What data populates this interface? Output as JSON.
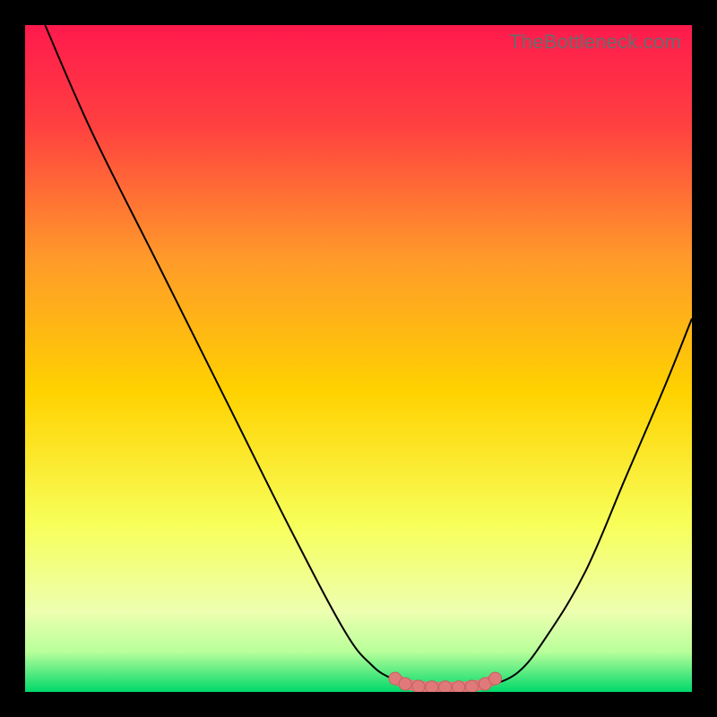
{
  "watermark": "TheBottleneck.com",
  "colors": {
    "black": "#000000",
    "curve": "#000000",
    "marker_fill": "#e07a7a",
    "marker_stroke": "#c95f5f",
    "grad_top": "#ff1a4d",
    "grad_mid_upper": "#ff7a3a",
    "grad_mid": "#ffd200",
    "grad_mid_lower": "#f7ff5a",
    "grad_pale": "#edffb0",
    "grad_green": "#00d86a"
  },
  "chart_data": {
    "type": "line",
    "title": "",
    "xlabel": "",
    "ylabel": "",
    "xlim": [
      0,
      100
    ],
    "ylim": [
      0,
      100
    ],
    "series": [
      {
        "name": "bottleneck-curve-left",
        "x": [
          3,
          10,
          20,
          30,
          40,
          48,
          52,
          55,
          58
        ],
        "y": [
          100,
          84,
          64,
          44,
          24,
          9,
          4,
          2,
          1
        ]
      },
      {
        "name": "bottleneck-curve-right",
        "x": [
          70,
          74,
          78,
          84,
          90,
          96,
          100
        ],
        "y": [
          1,
          3,
          8,
          18,
          32,
          46,
          56
        ]
      },
      {
        "name": "optimal-range-markers",
        "x": [
          55.5,
          57,
          59,
          61,
          63,
          65,
          67,
          69,
          70.5
        ],
        "y": [
          2.0,
          1.2,
          0.8,
          0.7,
          0.7,
          0.7,
          0.8,
          1.2,
          2.0
        ]
      }
    ],
    "gradient_stops": [
      {
        "pct": 0,
        "color": "#ff1a4d"
      },
      {
        "pct": 15,
        "color": "#ff4040"
      },
      {
        "pct": 35,
        "color": "#ff9a2a"
      },
      {
        "pct": 55,
        "color": "#ffd200"
      },
      {
        "pct": 75,
        "color": "#f7ff5a"
      },
      {
        "pct": 88,
        "color": "#edffb0"
      },
      {
        "pct": 94,
        "color": "#b8ff9a"
      },
      {
        "pct": 100,
        "color": "#00d86a"
      }
    ]
  }
}
